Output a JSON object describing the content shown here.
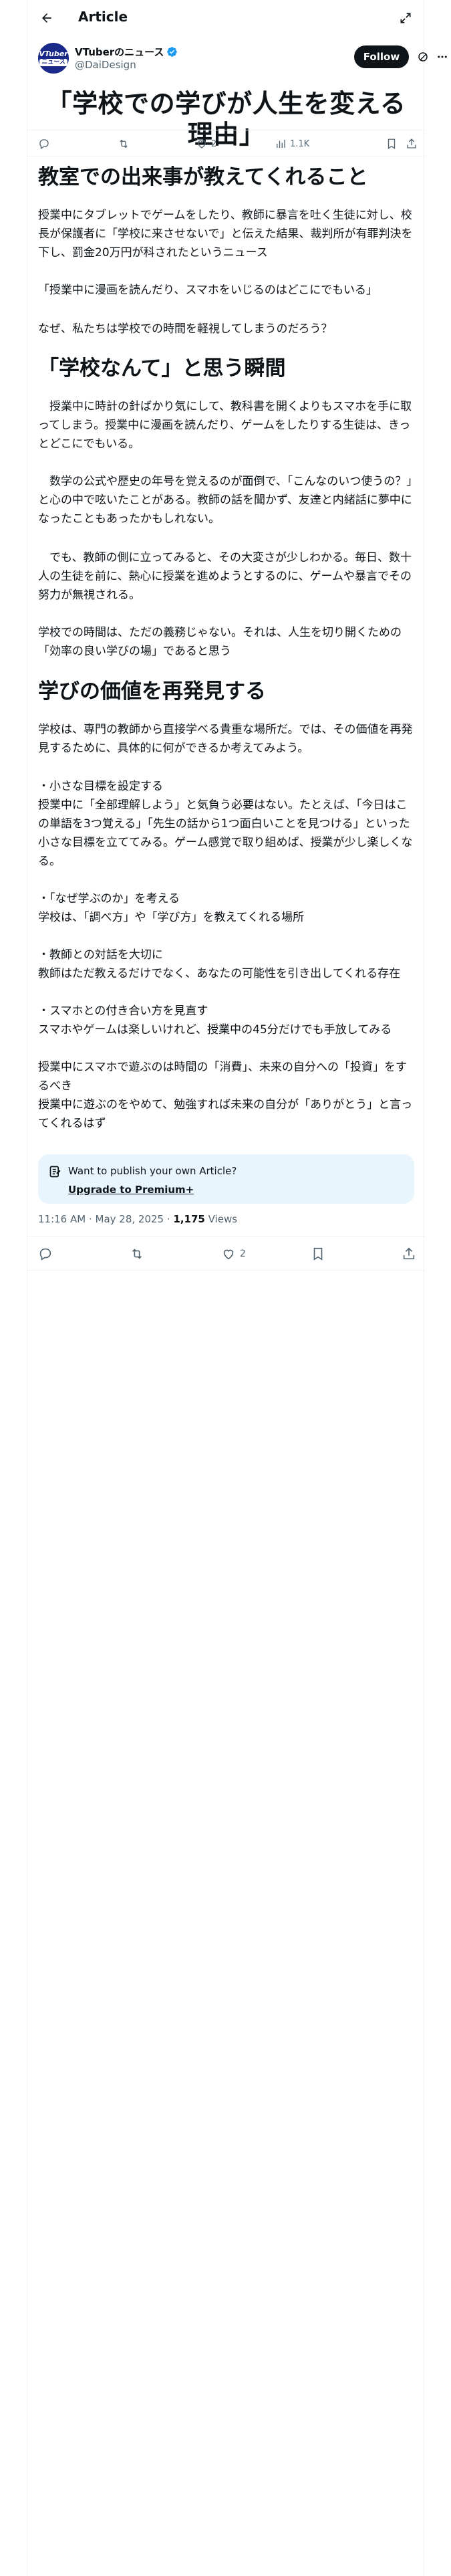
{
  "topbar": {
    "title": "Article"
  },
  "author": {
    "avatar_line1": "VTuber",
    "avatar_line2": "ニュース",
    "name": "VTuberのニュース",
    "handle": "@DaiDesign",
    "follow_label": "Follow"
  },
  "article": {
    "title": "「学校での学びが人生を変える理由」",
    "sections": [
      {
        "heading": "教室での出来事が教えてくれること",
        "paragraphs": [
          "授業中にタブレットでゲームをしたり、教師に暴言を吐く生徒に対し、校長が保護者に「学校に来させないで」と伝えた結果、裁判所が有罪判決を下し、罰金20万円が科されたというニュース",
          "「授業中に漫画を読んだり、スマホをいじるのはどこにでもいる」",
          "なぜ、私たちは学校での時間を軽視してしまうのだろう？"
        ]
      },
      {
        "heading": "「学校なんて」と思う瞬間",
        "paragraphs": [
          "　授業中に時計の針ばかり気にして、教科書を開くよりもスマホを手に取ってしまう。授業中に漫画を読んだり、ゲームをしたりする生徒は、きっとどこにでもいる。",
          "　数学の公式や歴史の年号を覚えるのが面倒で、「こんなのいつ使うの？」と心の中で呟いたことがある。教師の話を聞かず、友達と内緒話に夢中になったこともあったかもしれない。",
          "　でも、教師の側に立ってみると、その大変さが少しわかる。毎日、数十人の生徒を前に、熱心に授業を進めようとするのに、ゲームや暴言でその努力が無視される。",
          "学校での時間は、ただの義務じゃない。それは、人生を切り開くための「効率の良い学びの場」であると思う"
        ]
      },
      {
        "heading": "学びの価値を再発見する",
        "paragraphs": [
          "学校は、専門の教師から直接学べる貴重な場所だ。では、その価値を再発見するために、具体的に何ができるか考えてみよう。",
          "・小さな目標を設定する\n授業中に「全部理解しよう」と気負う必要はない。たとえば、「今日はこの単語を3つ覚える」「先生の話から1つ面白いことを見つける」といった小さな目標を立ててみる。ゲーム感覚で取り組めば、授業が少し楽しくなる。",
          "・「なぜ学ぶのか」を考える\n学校は、「調べ方」や「学び方」を教えてくれる場所",
          "・教師との対話を大切に\n教師はただ教えるだけでなく、あなたの可能性を引き出してくれる存在",
          "・スマホとの付き合い方を見直す\nスマホやゲームは楽しいけれど、授業中の45分だけでも手放してみる",
          "授業中にスマホで遊ぶのは時間の「消費」、未来の自分への「投資」をするべき\n授業中に遊ぶのをやめて、勉強すれば未来の自分が「ありがとう」と言ってくれるはず"
        ]
      }
    ]
  },
  "actions": {
    "reposts": "",
    "likes": "2",
    "views": "1.1K"
  },
  "promo": {
    "text": "Want to publish your own Article?",
    "link": "Upgrade to Premium+"
  },
  "meta": {
    "time": "11:16 AM · May 28, 2025 · ",
    "views_count": "1,175",
    "views_label": " Views"
  },
  "colors": {
    "accent": "#1d9bf0",
    "text": "#0f1419",
    "muted": "#536471",
    "promo_bg": "#e8f5fd"
  }
}
